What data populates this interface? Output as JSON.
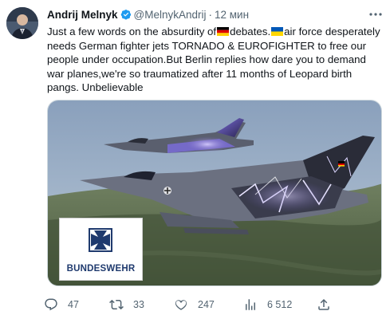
{
  "author": {
    "name": "Andrij Melnyk",
    "handle": "@MelnykAndrij",
    "separator": "·",
    "time": "12 мин"
  },
  "tweet": {
    "seg1": "Just a few words on the absurdity of",
    "seg2": "debates.",
    "seg3": "air force desperately needs German fighter jets TORNADO & EUROFIGHTER to free our people under occupation.But Berlin replies how dare you to demand war planes,we're so traumatized after 11 months of Leopard birth pangs. Unbelievable"
  },
  "media": {
    "logo_text": "BUNDESWEHR"
  },
  "actions": {
    "replies": "47",
    "retweets": "33",
    "likes": "247",
    "views": "6 512"
  },
  "icons": {
    "verified": "verified-badge-icon",
    "more": "more-options-icon",
    "reply": "reply-icon",
    "retweet": "retweet-icon",
    "like": "heart-icon",
    "views": "views-bar-chart-icon",
    "share": "share-icon",
    "flag_de": "germany-flag-icon",
    "flag_ua": "ukraine-flag-icon"
  },
  "colors": {
    "verified": "#1d9bf0",
    "muted": "#536471",
    "flag_de": [
      "#000000",
      "#dd0000",
      "#ffce00"
    ],
    "flag_ua": [
      "#0057b7",
      "#ffd700"
    ]
  }
}
